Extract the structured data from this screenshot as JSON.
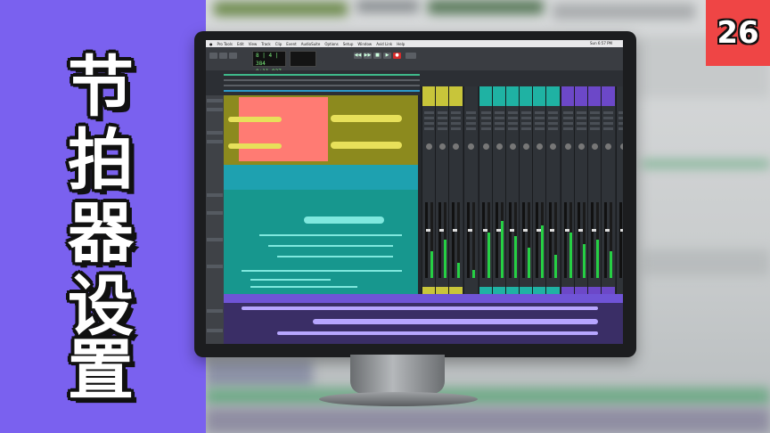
{
  "thumbnail": {
    "title_chars": [
      "节",
      "拍",
      "器",
      "设",
      "置"
    ],
    "episode_number": "26"
  },
  "daw": {
    "menu_items": [
      "Pro Tools",
      "Edit",
      "View",
      "Track",
      "Clip",
      "Event",
      "AudioSuite",
      "Options",
      "Setup",
      "Window",
      "Avid Link",
      "Help"
    ],
    "clock": "Sun 6:57 PM",
    "counter_main": "8 | 4 | 384",
    "counter_sub": "0:11.827",
    "transport_icons": [
      "rewind-icon",
      "fast-forward-icon",
      "stop-icon",
      "play-icon",
      "record-icon"
    ]
  },
  "colors": {
    "left_panel": "#7a61ef",
    "badge": "#ef4545",
    "track_olive": "#8c8a1e",
    "clip_red": "#ff7b73",
    "track_teal": "#17978e",
    "track_purple": "#6a4fd0",
    "mixer_yellow": "#c8c53a",
    "mixer_teal": "#1fb2a3",
    "mixer_purple": "#6c48c8",
    "meter_green": "#26d044"
  }
}
